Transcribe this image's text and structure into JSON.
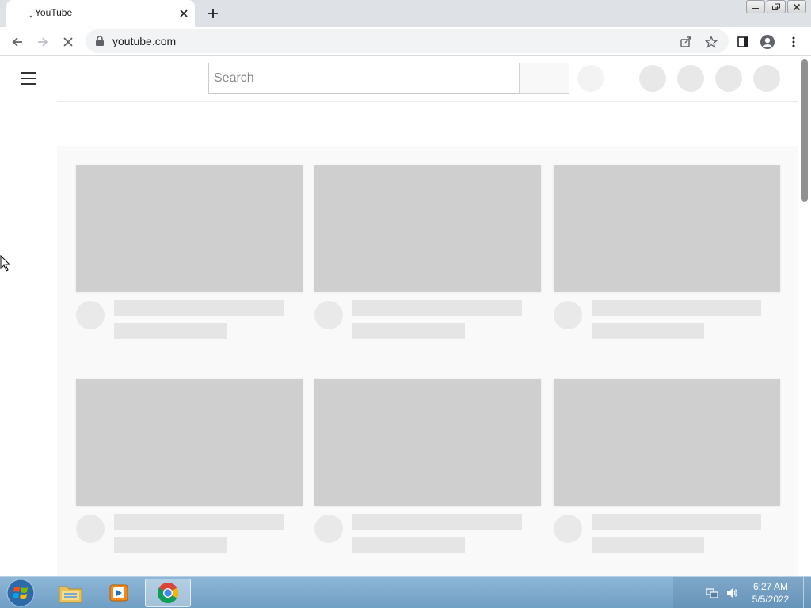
{
  "browser": {
    "tab": {
      "title": "YouTube"
    },
    "url": "youtube.com"
  },
  "page": {
    "search": {
      "placeholder": "Search",
      "value": ""
    },
    "content_state": "loading-skeleton"
  },
  "colors": {
    "tabstrip": "#dee1e6",
    "skeleton_thumb": "#cfcfcf",
    "skeleton_line": "#e5e5e5",
    "content_bg": "#f9f9f9"
  },
  "taskbar": {
    "apps": [
      {
        "name": "windows-explorer",
        "active": false
      },
      {
        "name": "windows-media-player",
        "active": false
      },
      {
        "name": "google-chrome",
        "active": true
      }
    ],
    "clock": {
      "time": "6:27 AM",
      "date": "5/5/2022"
    }
  }
}
